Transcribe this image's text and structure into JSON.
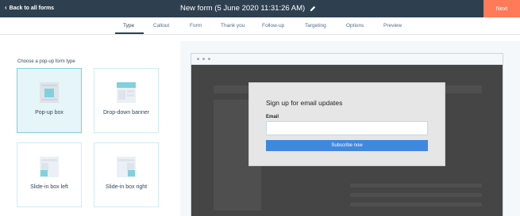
{
  "header": {
    "back_label": "Back to all forms",
    "form_title": "New form (5 June 2020 11:31:26 AM)",
    "next_label": "Next"
  },
  "tabs": [
    {
      "label": "Type",
      "active": true
    },
    {
      "label": "Callout",
      "active": false
    },
    {
      "label": "Form",
      "active": false
    },
    {
      "label": "Thank you",
      "active": false
    },
    {
      "label": "Follow-up",
      "active": false
    },
    {
      "label": "Targeting",
      "active": false
    },
    {
      "label": "Options",
      "active": false
    },
    {
      "label": "Preview",
      "active": false
    }
  ],
  "left_panel": {
    "heading": "Choose a pop-up form type",
    "types": [
      {
        "label": "Pop-up box",
        "selected": true,
        "icon": "popup-box-icon"
      },
      {
        "label": "Drop-down banner",
        "selected": false,
        "icon": "dropdown-banner-icon"
      },
      {
        "label": "Slide-in box left",
        "selected": false,
        "icon": "slide-in-left-icon"
      },
      {
        "label": "Slide-in box right",
        "selected": false,
        "icon": "slide-in-right-icon"
      }
    ]
  },
  "preview": {
    "popup_title": "Sign up for email updates",
    "email_label": "Email",
    "email_value": "",
    "button_label": "Subscribe now"
  },
  "colors": {
    "topbar": "#2e3f50",
    "next_button": "#ff7a59",
    "accent_teal": "#00a4bd",
    "subscribe_button": "#3f88e0"
  }
}
